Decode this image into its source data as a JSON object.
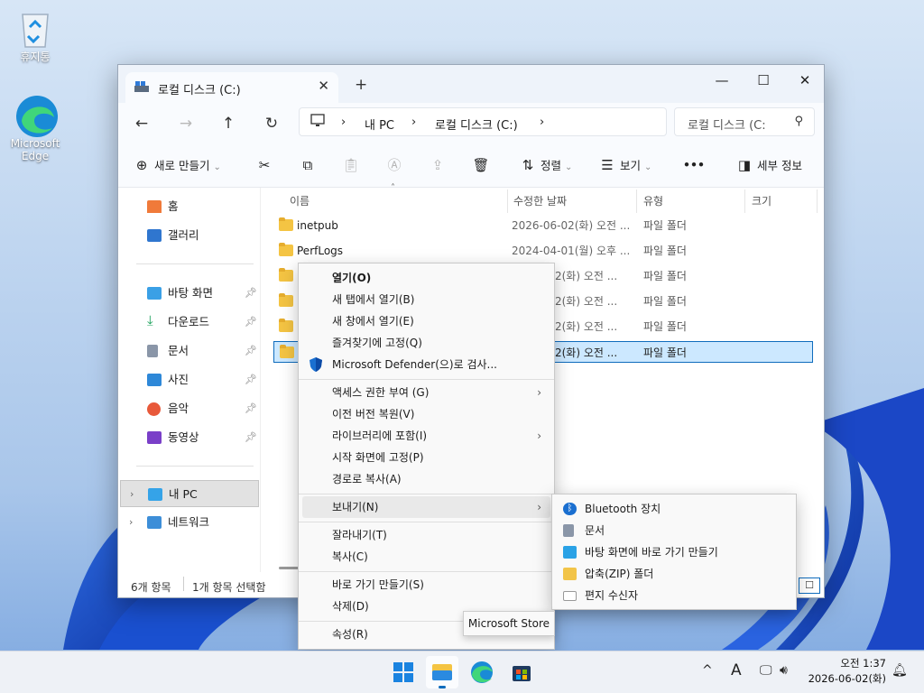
{
  "desktop": {
    "icons": [
      {
        "label": "휴지통"
      },
      {
        "label": "Microsoft Edge"
      }
    ]
  },
  "explorer": {
    "tab_title": "로컬 디스크 (C:)",
    "window_controls": {
      "minimize": "—",
      "maximize": "☐",
      "close": "✕"
    },
    "breadcrumb": [
      "내 PC",
      "로컬 디스크 (C:)"
    ],
    "search_placeholder": "로컬 디스크 (C:",
    "toolbar": {
      "new": "새로 만들기",
      "sort": "정렬",
      "view": "보기",
      "more": "•••",
      "details": "세부 정보"
    },
    "navpane": {
      "home": "홈",
      "gallery": "갤러리",
      "quick": [
        "바탕 화면",
        "다운로드",
        "문서",
        "사진",
        "음악",
        "동영상"
      ],
      "this_pc": "내 PC",
      "network": "네트워크"
    },
    "columns": [
      "이름",
      "수정한 날짜",
      "유형",
      "크기"
    ],
    "files": [
      {
        "name": "inetpub",
        "date": "2026-06-02(화) 오전 ...",
        "type": "파일 폴더"
      },
      {
        "name": "PerfLogs",
        "date": "2024-04-01(월) 오후 ...",
        "type": "파일 폴더"
      },
      {
        "name": "",
        "date": "-02(화) 오전 ...",
        "type": "파일 폴더"
      },
      {
        "name": "",
        "date": "-02(화) 오전 ...",
        "type": "파일 폴더"
      },
      {
        "name": "",
        "date": "-02(화) 오전 ...",
        "type": "파일 폴더"
      },
      {
        "name": "",
        "date": "-02(화) 오전 ...",
        "type": "파일 폴더"
      }
    ],
    "status": {
      "count": "6개 항목",
      "selected": "1개 항목 선택함"
    }
  },
  "context_menu": {
    "items": [
      "열기(O)",
      "새 탭에서 열기(B)",
      "새 창에서 열기(E)",
      "즐겨찾기에 고정(Q)",
      "Microsoft Defender(으)로 검사...",
      "액세스 권한 부여 (G)",
      "이전 버전 복원(V)",
      "라이브러리에 포함(I)",
      "시작 화면에 고정(P)",
      "경로로 복사(A)",
      "보내기(N)",
      "잘라내기(T)",
      "복사(C)",
      "바로 가기 만들기(S)",
      "삭제(D)",
      "속성(R)"
    ]
  },
  "send_to_menu": {
    "items": [
      "Bluetooth 장치",
      "문서",
      "바탕 화면에 바로 가기 만들기",
      "압축(ZIP) 폴더",
      "편지 수신자"
    ]
  },
  "tooltip": "Microsoft Store",
  "taskbar": {
    "clock_time": "오전 1:37",
    "clock_date": "2026-06-02(화)",
    "ime": "A"
  }
}
